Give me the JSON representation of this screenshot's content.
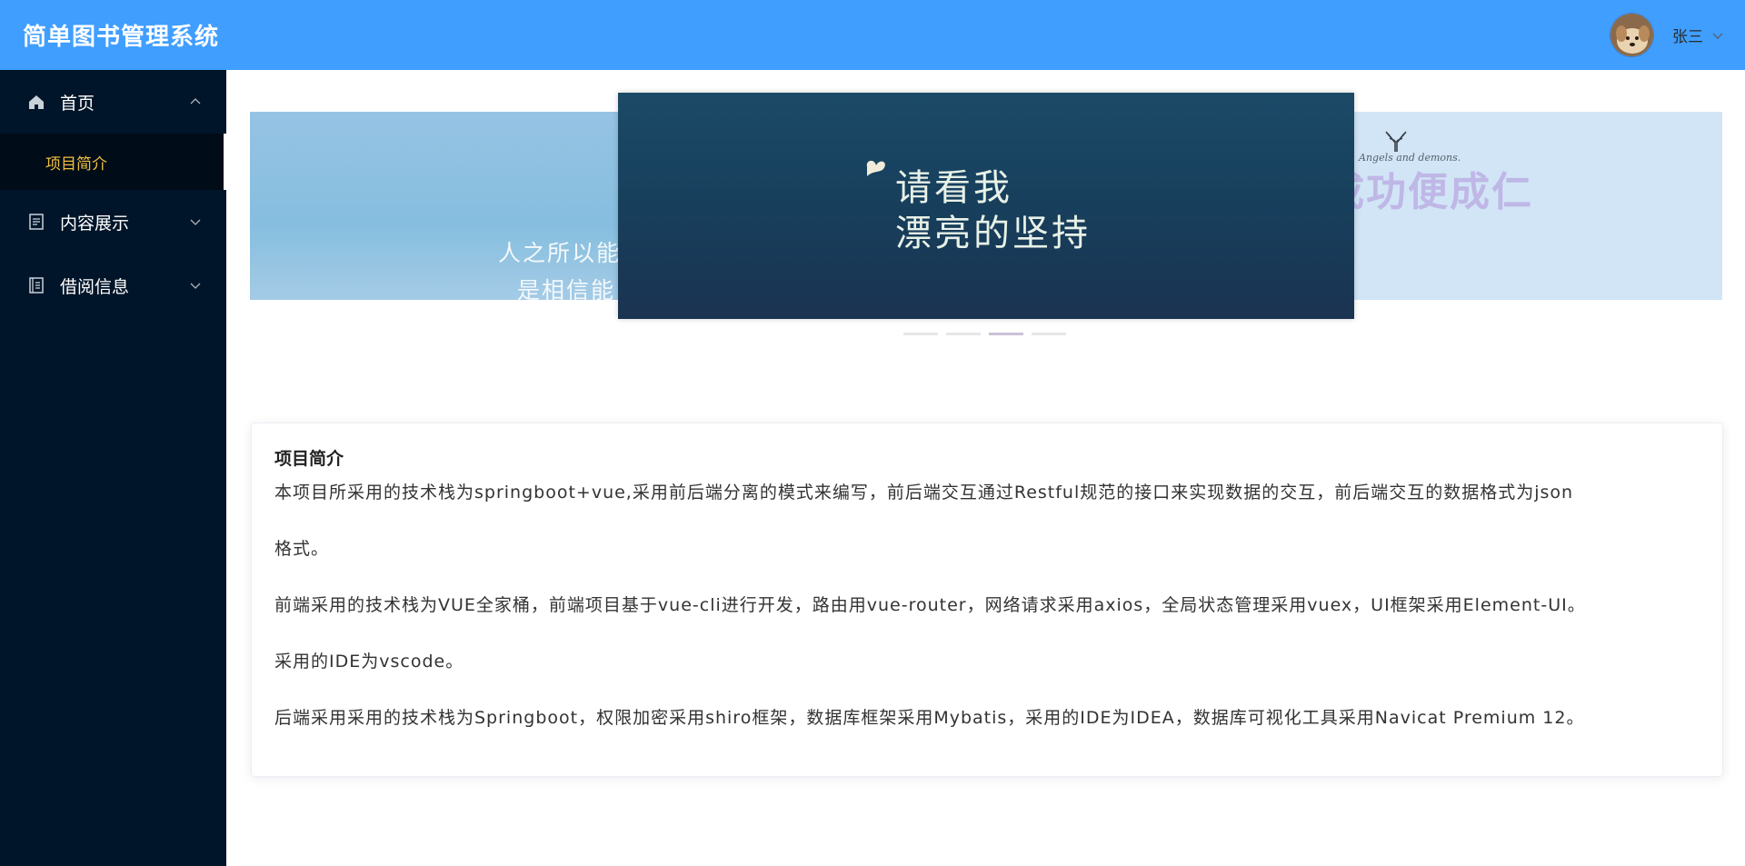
{
  "header": {
    "app_title": "简单图书管理系统",
    "user_name": "张三",
    "avatar_icon": "dog-avatar",
    "dropdown_icon": "chevron-down-icon",
    "bg_color": "#409eff"
  },
  "sidebar": {
    "bg_color": "#001529",
    "items": [
      {
        "label": "首页",
        "icon": "home-icon",
        "expanded": true,
        "children": [
          {
            "label": "项目简介",
            "active": true
          }
        ]
      },
      {
        "label": "内容展示",
        "icon": "document-icon",
        "expanded": false
      },
      {
        "label": "借阅信息",
        "icon": "notebook-icon",
        "expanded": false
      }
    ]
  },
  "carousel": {
    "slides": [
      {
        "lines": [
          "人之所以能",
          "是相信能"
        ]
      },
      {
        "lines": [
          "请看我",
          "漂亮的坚持"
        ]
      },
      {
        "lines": [
          "Angels and demons.",
          "成功便成仁"
        ]
      }
    ],
    "indicator_count": 4,
    "active_indicator": 3
  },
  "intro": {
    "title": "项目简介",
    "paragraphs": [
      "本项目所采用的技术栈为springboot+vue,采用前后端分离的模式来编写，前后端交互通过Restful规范的接口来实现数据的交互，前后端交互的数据格式为json",
      "格式。",
      "前端采用的技术栈为VUE全家桶，前端项目基于vue-cli进行开发，路由用vue-router，网络请求采用axios，全局状态管理采用vuex，UI框架采用Element-UI。",
      "采用的IDE为vscode。",
      "后端采用采用的技术栈为Springboot，权限加密采用shiro框架，数据库框架采用Mybatis，采用的IDE为IDEA，数据库可视化工具采用Navicat Premium 12。"
    ]
  }
}
